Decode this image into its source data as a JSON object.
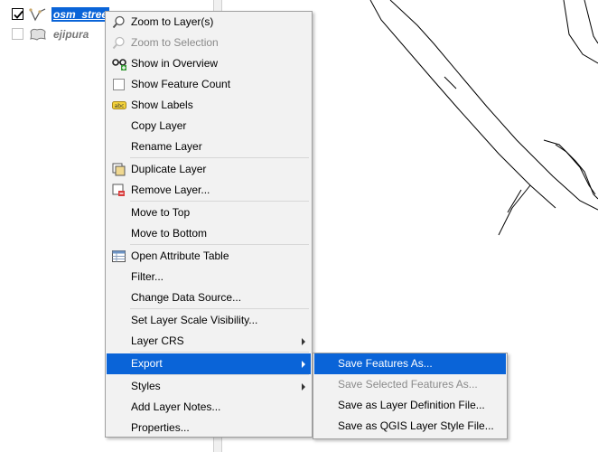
{
  "layers": [
    {
      "name": "osm_streets",
      "display": "osm_stree",
      "checked": true
    },
    {
      "name": "ejipura",
      "display": "ejipura",
      "checked": false
    }
  ],
  "context_menu": {
    "items": [
      {
        "label": "Zoom to Layer(s)",
        "icon": "zoom-layer-icon"
      },
      {
        "label": "Zoom to Selection",
        "icon": "zoom-selection-icon",
        "disabled": true
      },
      {
        "label": "Show in Overview",
        "icon": "overview-glasses-icon"
      },
      {
        "label": "Show Feature Count",
        "icon": "checkbox-icon"
      },
      {
        "label": "Show Labels",
        "icon": "labels-abc-icon"
      },
      {
        "label": "Copy Layer"
      },
      {
        "label": "Rename Layer"
      },
      {
        "label": "Duplicate Layer",
        "icon": "duplicate-layer-icon"
      },
      {
        "label": "Remove Layer...",
        "icon": "remove-layer-icon"
      },
      {
        "label": "Move to Top"
      },
      {
        "label": "Move to Bottom"
      },
      {
        "label": "Open Attribute Table",
        "icon": "attribute-table-icon"
      },
      {
        "label": "Filter..."
      },
      {
        "label": "Change Data Source..."
      },
      {
        "label": "Set Layer Scale Visibility..."
      },
      {
        "label": "Layer CRS",
        "submenu": true
      },
      {
        "label": "Export",
        "submenu": true,
        "active": true
      },
      {
        "label": "Styles",
        "submenu": true
      },
      {
        "label": "Add Layer Notes..."
      },
      {
        "label": "Properties..."
      }
    ]
  },
  "export_submenu": {
    "items": [
      {
        "label": "Save Features As...",
        "active": true
      },
      {
        "label": "Save Selected Features As...",
        "disabled": true
      },
      {
        "label": "Save as Layer Definition File..."
      },
      {
        "label": "Save as QGIS Layer Style File..."
      }
    ]
  },
  "colors": {
    "highlight": "#0a64d8",
    "menu_bg": "#f2f2f2",
    "disabled_text": "#8a8a8a"
  }
}
